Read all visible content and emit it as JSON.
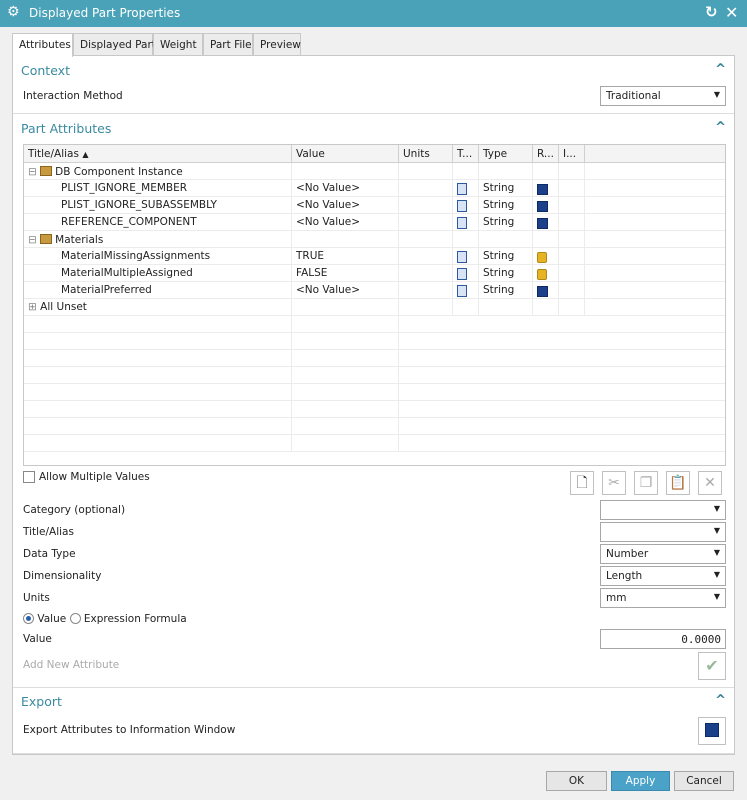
{
  "window": {
    "title": "Displayed Part Properties"
  },
  "tabs": [
    "Attributes",
    "Displayed Part",
    "Weight",
    "Part File",
    "Preview"
  ],
  "context": {
    "header": "Context",
    "interaction_label": "Interaction Method",
    "interaction_value": "Traditional"
  },
  "part_attributes": {
    "header": "Part Attributes",
    "columns": [
      "Title/Alias",
      "Value",
      "Units",
      "T...",
      "Type",
      "R...",
      "I..."
    ],
    "rows": [
      {
        "kind": "group",
        "title": "DB Component Instance"
      },
      {
        "kind": "item",
        "title": "PLIST_IGNORE_MEMBER",
        "value": "<No Value>",
        "type": "String",
        "r": "save-icon"
      },
      {
        "kind": "item",
        "title": "PLIST_IGNORE_SUBASSEMBLY",
        "value": "<No Value>",
        "type": "String",
        "r": "save-icon"
      },
      {
        "kind": "item",
        "title": "REFERENCE_COMPONENT",
        "value": "<No Value>",
        "type": "String",
        "r": "save-icon"
      },
      {
        "kind": "group",
        "title": "Materials"
      },
      {
        "kind": "item",
        "title": "MaterialMissingAssignments",
        "value": "TRUE",
        "type": "String",
        "r": "lock-icon"
      },
      {
        "kind": "item",
        "title": "MaterialMultipleAssigned",
        "value": "FALSE",
        "type": "String",
        "r": "lock-icon"
      },
      {
        "kind": "item",
        "title": "MaterialPreferred",
        "value": "<No Value>",
        "type": "String",
        "r": "save-icon"
      },
      {
        "kind": "collapsed",
        "title": "All Unset"
      }
    ]
  },
  "form": {
    "allow_multiple": "Allow Multiple Values",
    "category_label": "Category (optional)",
    "category_value": "",
    "title_label": "Title/Alias",
    "title_value": "",
    "datatype_label": "Data Type",
    "datatype_value": "Number",
    "dimensionality_label": "Dimensionality",
    "dimensionality_value": "Length",
    "units_label": "Units",
    "units_value": "mm",
    "radio_value": "Value",
    "radio_expression": "Expression Formula",
    "value_label": "Value",
    "value_value": "0.0000",
    "add_new": "Add New Attribute"
  },
  "export": {
    "header": "Export",
    "label": "Export Attributes to Information Window"
  },
  "footer": {
    "ok": "OK",
    "apply": "Apply",
    "cancel": "Cancel"
  },
  "colors": {
    "titlebar": "#4aa2b8",
    "section": "#3a8aa0",
    "apply": "#4aa2c8"
  }
}
